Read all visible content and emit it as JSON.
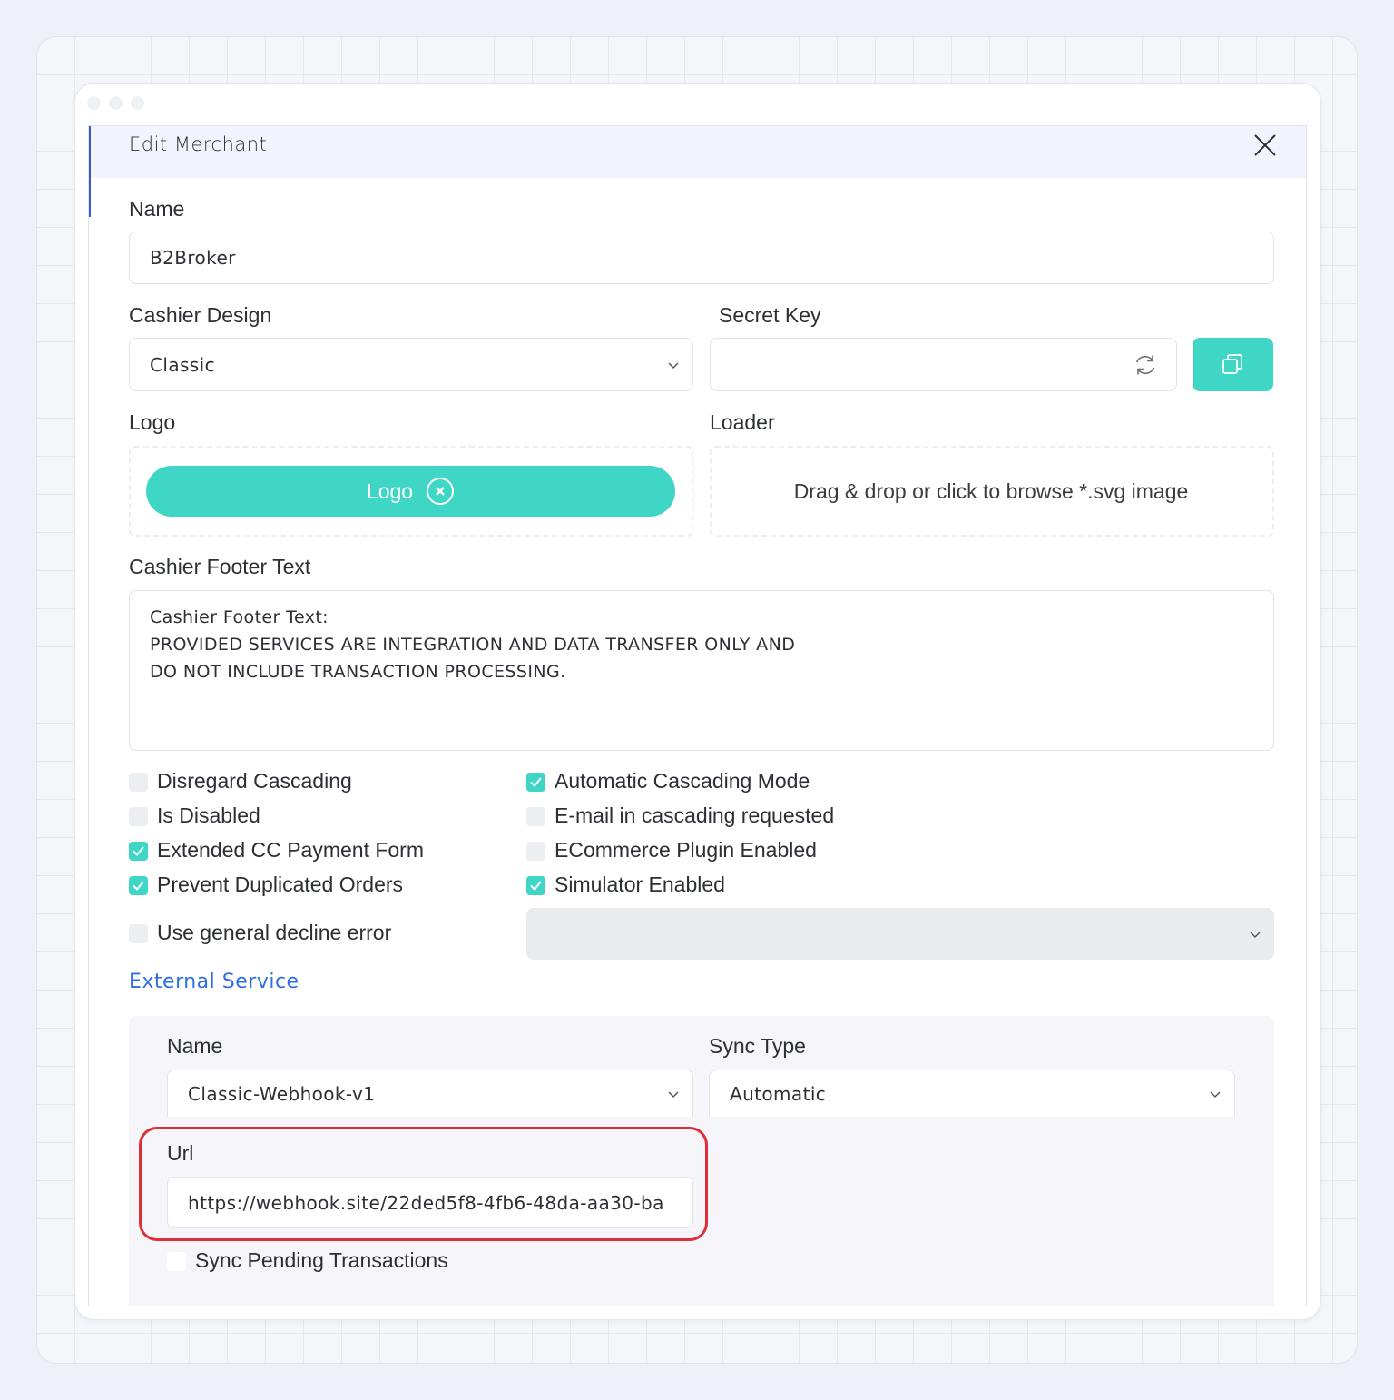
{
  "dialog": {
    "title": "Edit Merchant"
  },
  "name": {
    "label": "Name",
    "value": "B2Broker"
  },
  "cashier_design": {
    "label": "Cashier Design",
    "value": "Classic"
  },
  "secret_key": {
    "label": "Secret Key",
    "value": ""
  },
  "logo": {
    "label": "Logo",
    "button_label": "Logo"
  },
  "loader": {
    "label": "Loader",
    "drop_text": "Drag & drop or click to browse *.svg image"
  },
  "footer_text": {
    "label": "Cashier Footer Text",
    "lines": [
      "Cashier Footer Text:",
      "PROVIDED SERVICES ARE INTEGRATION AND DATA TRANSFER ONLY AND",
      "DO NOT INCLUDE TRANSACTION PROCESSING."
    ]
  },
  "checkboxes": {
    "disregard_cascading": {
      "label": "Disregard Cascading",
      "checked": false
    },
    "is_disabled": {
      "label": "Is Disabled",
      "checked": false
    },
    "extended_cc": {
      "label": "Extended CC Payment Form",
      "checked": true
    },
    "prevent_duplicated": {
      "label": "Prevent Duplicated Orders",
      "checked": true
    },
    "use_general_decline": {
      "label": "Use general decline error",
      "checked": false
    },
    "automatic_cascading": {
      "label": "Automatic Cascading Mode",
      "checked": true
    },
    "email_cascading": {
      "label": "E-mail in cascading requested",
      "checked": false
    },
    "ecommerce_plugin": {
      "label": "ECommerce Plugin Enabled",
      "checked": false
    },
    "simulator_enabled": {
      "label": "Simulator Enabled",
      "checked": true
    }
  },
  "decline_error_select": {
    "value": ""
  },
  "external_service": {
    "link_label": "External Service",
    "name": {
      "label": "Name",
      "value": "Classic-Webhook-v1"
    },
    "sync_type": {
      "label": "Sync Type",
      "value": "Automatic"
    },
    "url": {
      "label": "Url",
      "value": "https://webhook.site/22ded5f8-4fb6-48da-aa30-ba"
    },
    "sync_pending": {
      "label": "Sync Pending Transactions",
      "checked": false
    }
  },
  "colors": {
    "accent": "#3fd6c6",
    "link": "#2f6fe0",
    "highlight": "#e02d3a"
  },
  "icons": [
    "close-icon",
    "chevron-down-icon",
    "refresh-icon",
    "copy-icon",
    "clear-icon",
    "checkmark-icon"
  ]
}
